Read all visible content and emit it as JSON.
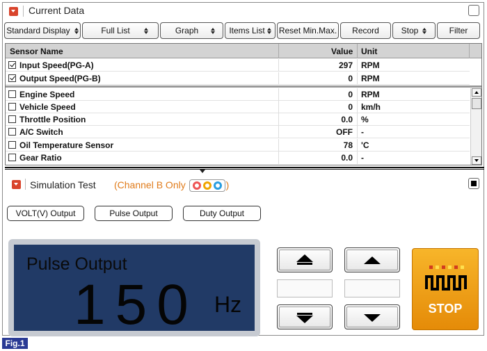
{
  "current_data": {
    "title": "Current Data",
    "toolbar": {
      "standard_display": "Standard Display",
      "full_list": "Full List",
      "graph": "Graph",
      "items_list": "Items List",
      "reset_min_max": "Reset Min.Max.",
      "record": "Record",
      "stop": "Stop",
      "filter": "Filter"
    },
    "columns": {
      "name": "Sensor Name",
      "value": "Value",
      "unit": "Unit"
    },
    "fixed_rows": [
      {
        "name": "Input Speed(PG-A)",
        "value": "297",
        "unit": "RPM",
        "checked": true
      },
      {
        "name": "Output Speed(PG-B)",
        "value": "0",
        "unit": "RPM",
        "checked": true
      }
    ],
    "rows": [
      {
        "name": "Engine Speed",
        "value": "0",
        "unit": "RPM",
        "checked": false
      },
      {
        "name": "Vehicle Speed",
        "value": "0",
        "unit": "km/h",
        "checked": false
      },
      {
        "name": "Throttle Position",
        "value": "0.0",
        "unit": "%",
        "checked": false
      },
      {
        "name": "A/C Switch",
        "value": "OFF",
        "unit": "-",
        "checked": false
      },
      {
        "name": "Oil Temperature Sensor",
        "value": "78",
        "unit": "'C",
        "checked": false
      },
      {
        "name": "Gear Ratio",
        "value": "0.0",
        "unit": "-",
        "checked": false
      }
    ]
  },
  "simulation_test": {
    "title": "Simulation Test",
    "channel_open": "(Channel B Only",
    "channel_close": ")",
    "output_buttons": {
      "volt": "VOLT(V) Output",
      "pulse": "Pulse Output",
      "duty": "Duty Output"
    },
    "display": {
      "label": "Pulse Output",
      "value": "150",
      "unit": "Hz"
    },
    "stop_label": "STOP"
  },
  "figure_label": "Fig.1",
  "colors": {
    "accent_red": "#d9442c",
    "channel_orange": "#e07b1a",
    "display_bg": "#213a66",
    "stop_orange": "#f0a020",
    "fig_blue": "#2a3a94"
  }
}
